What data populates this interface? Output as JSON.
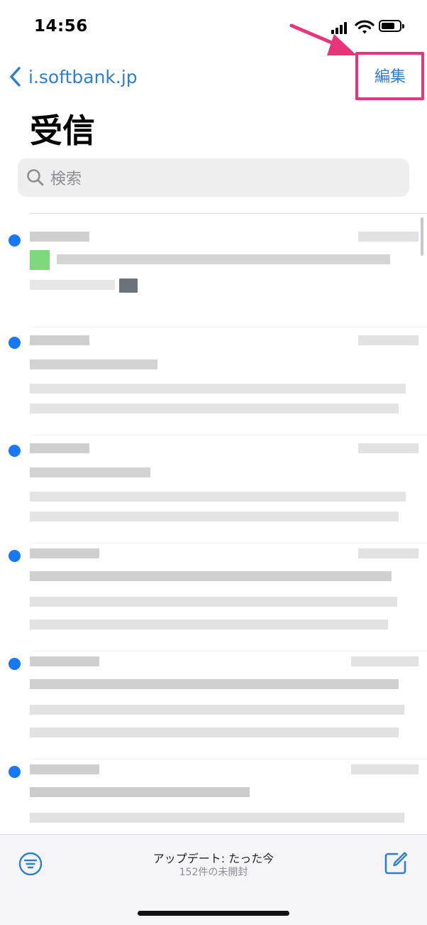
{
  "status_bar": {
    "time": "14:56"
  },
  "nav": {
    "back_label": "i.softbank.jp",
    "edit_label": "編集"
  },
  "header": {
    "title": "受信"
  },
  "search": {
    "placeholder": "検索"
  },
  "toolbar": {
    "update_status": "アップデート: たった今",
    "unread_count": "152件の未開封"
  },
  "colors": {
    "accent": "#2f7fd1",
    "unread_dot": "#1877f2",
    "highlight": "#e8347a"
  },
  "messages": [
    {
      "unread": true,
      "sender": "",
      "subject": "",
      "preview": ""
    },
    {
      "unread": true,
      "sender": "",
      "subject": "",
      "preview": ""
    },
    {
      "unread": true,
      "sender": "",
      "subject": "",
      "preview": ""
    },
    {
      "unread": true,
      "sender": "",
      "subject": "",
      "preview": ""
    },
    {
      "unread": true,
      "sender": "",
      "subject": "",
      "preview": ""
    },
    {
      "unread": true,
      "sender": "",
      "subject": "",
      "preview": ""
    }
  ]
}
